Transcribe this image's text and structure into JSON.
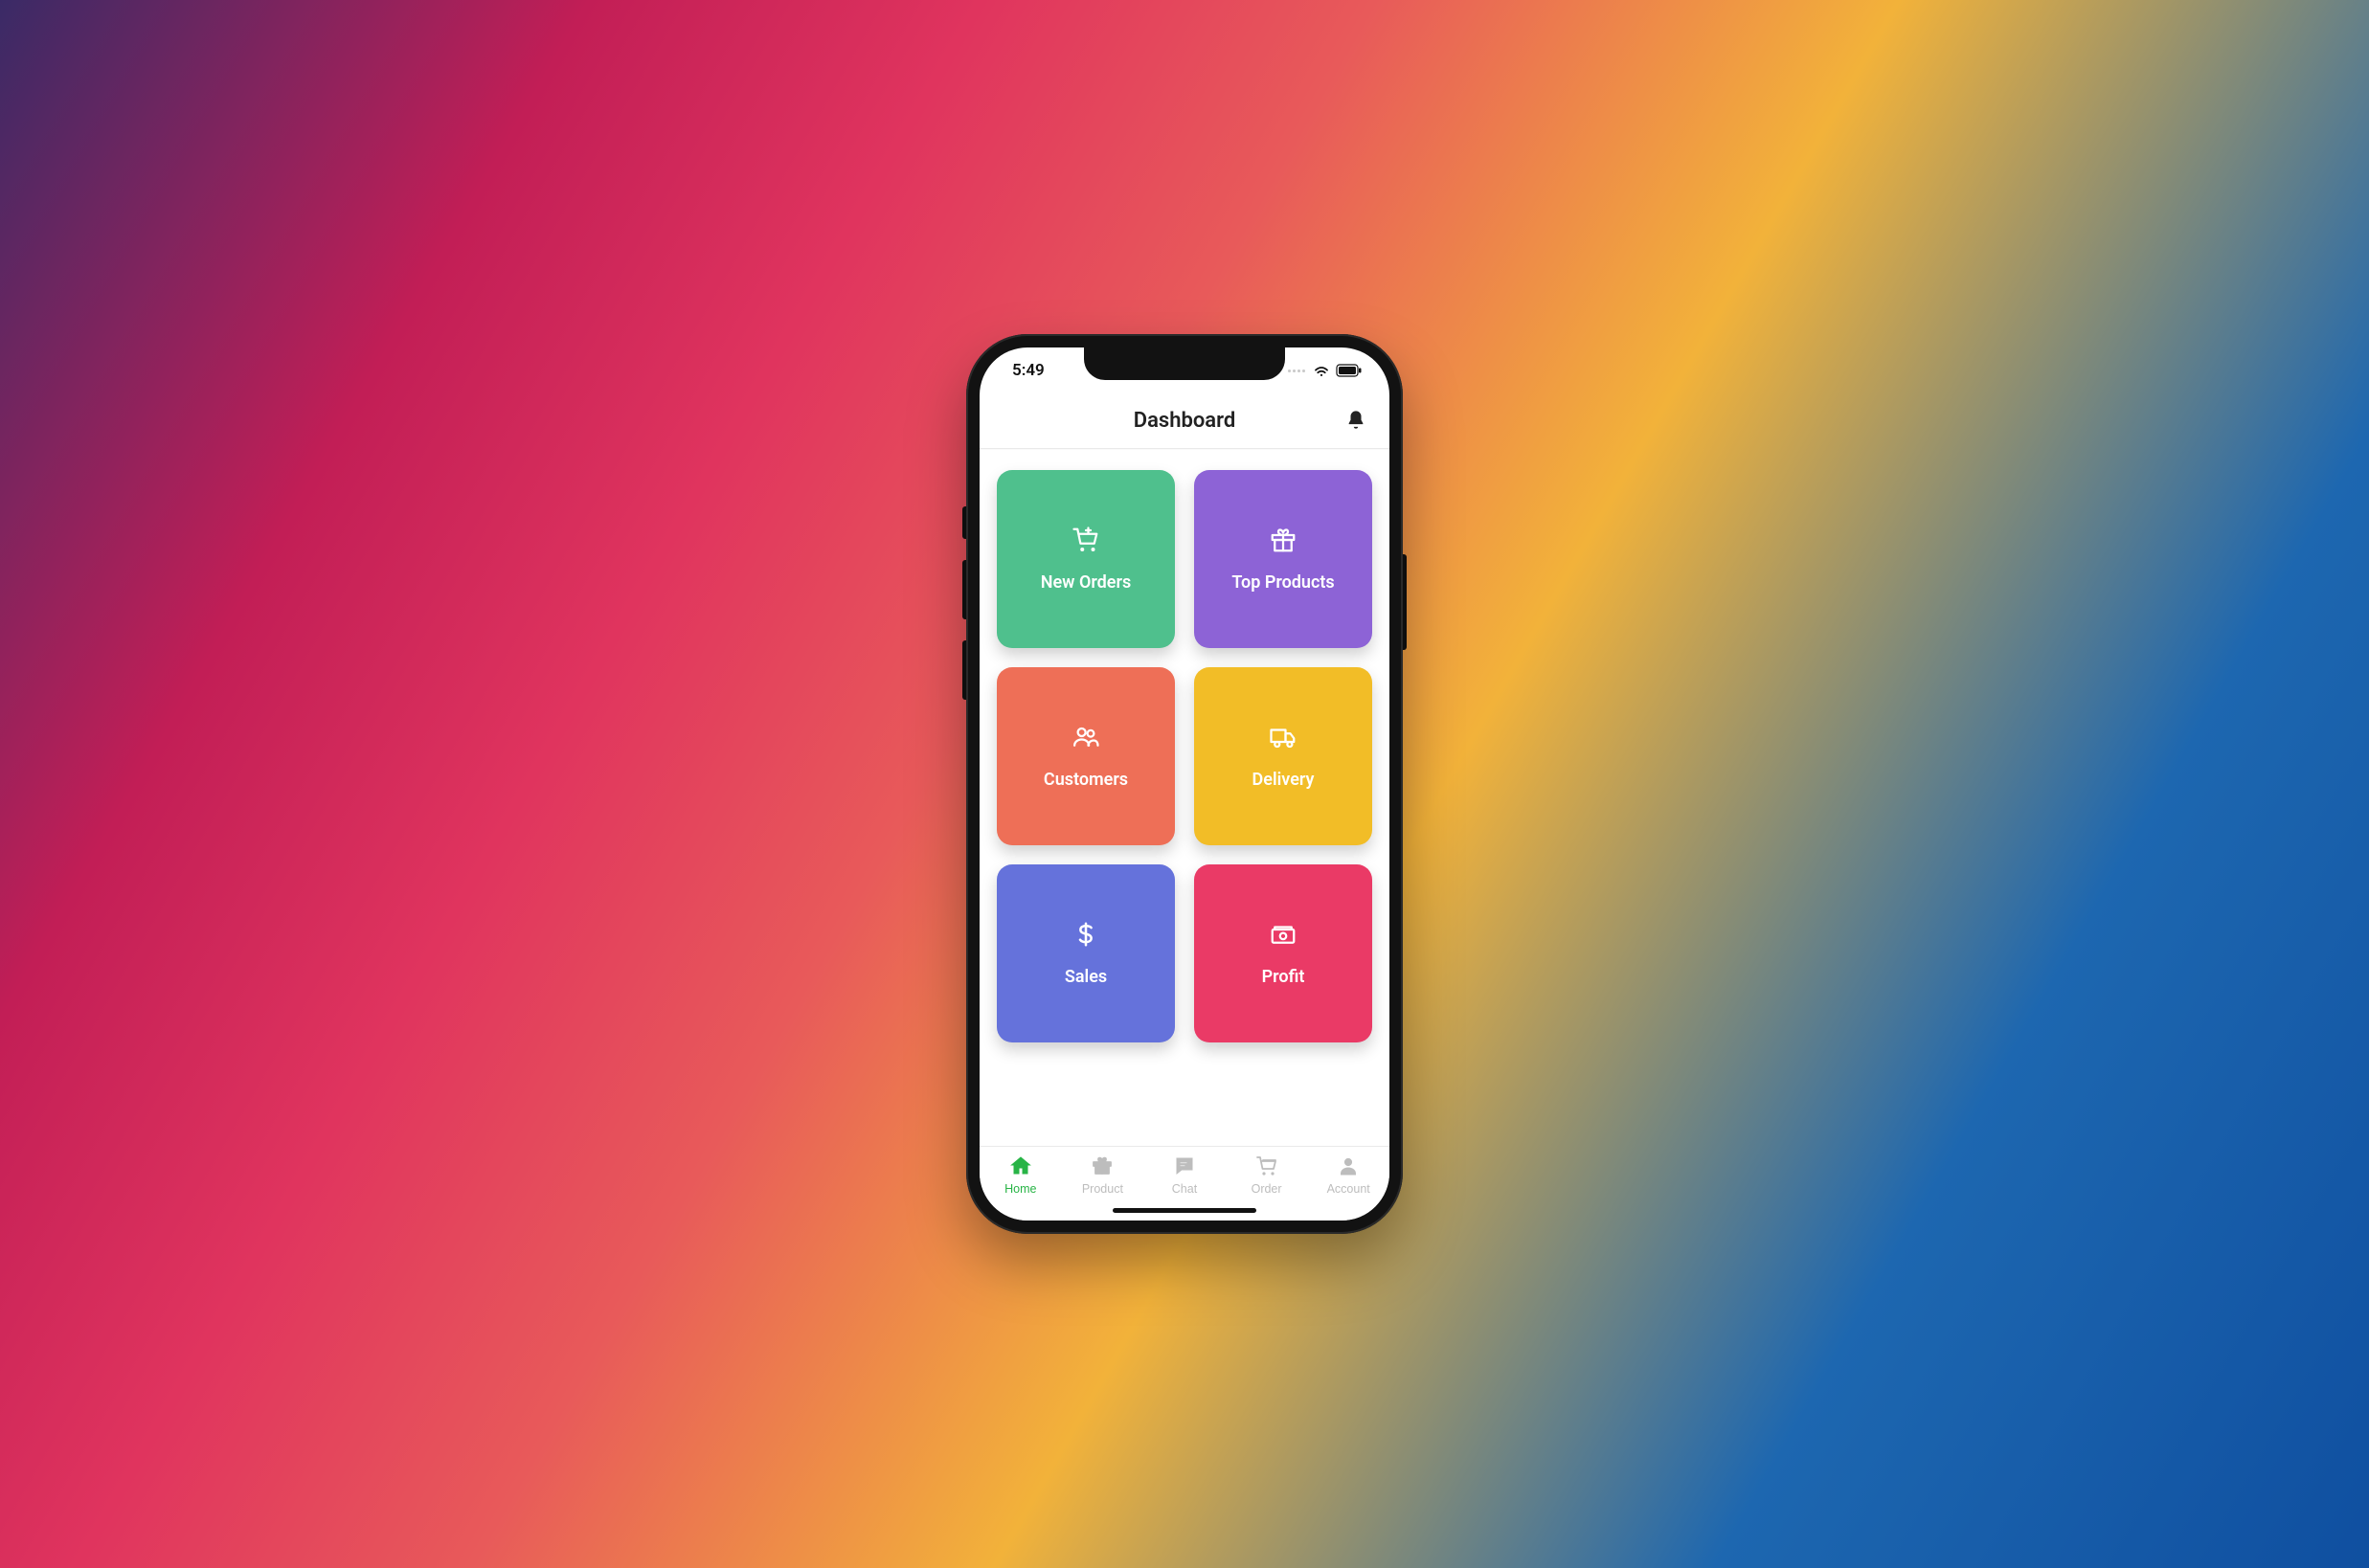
{
  "status_bar": {
    "time": "5:49"
  },
  "header": {
    "title": "Dashboard"
  },
  "tiles": [
    {
      "label": "New Orders",
      "icon": "cart-plus-icon",
      "color": "#4fc08d"
    },
    {
      "label": "Top Products",
      "icon": "gift-icon",
      "color": "#8d63d6"
    },
    {
      "label": "Customers",
      "icon": "users-icon",
      "color": "#ee6f57"
    },
    {
      "label": "Delivery",
      "icon": "truck-icon",
      "color": "#f2bd27"
    },
    {
      "label": "Sales",
      "icon": "dollar-icon",
      "color": "#6572db"
    },
    {
      "label": "Profit",
      "icon": "money-icon",
      "color": "#ea3a66"
    }
  ],
  "bottom_nav": [
    {
      "label": "Home",
      "icon": "home-icon",
      "active": true
    },
    {
      "label": "Product",
      "icon": "gift-small-icon",
      "active": false
    },
    {
      "label": "Chat",
      "icon": "chat-icon",
      "active": false
    },
    {
      "label": "Order",
      "icon": "cart-icon",
      "active": false
    },
    {
      "label": "Account",
      "icon": "account-icon",
      "active": false
    }
  ]
}
